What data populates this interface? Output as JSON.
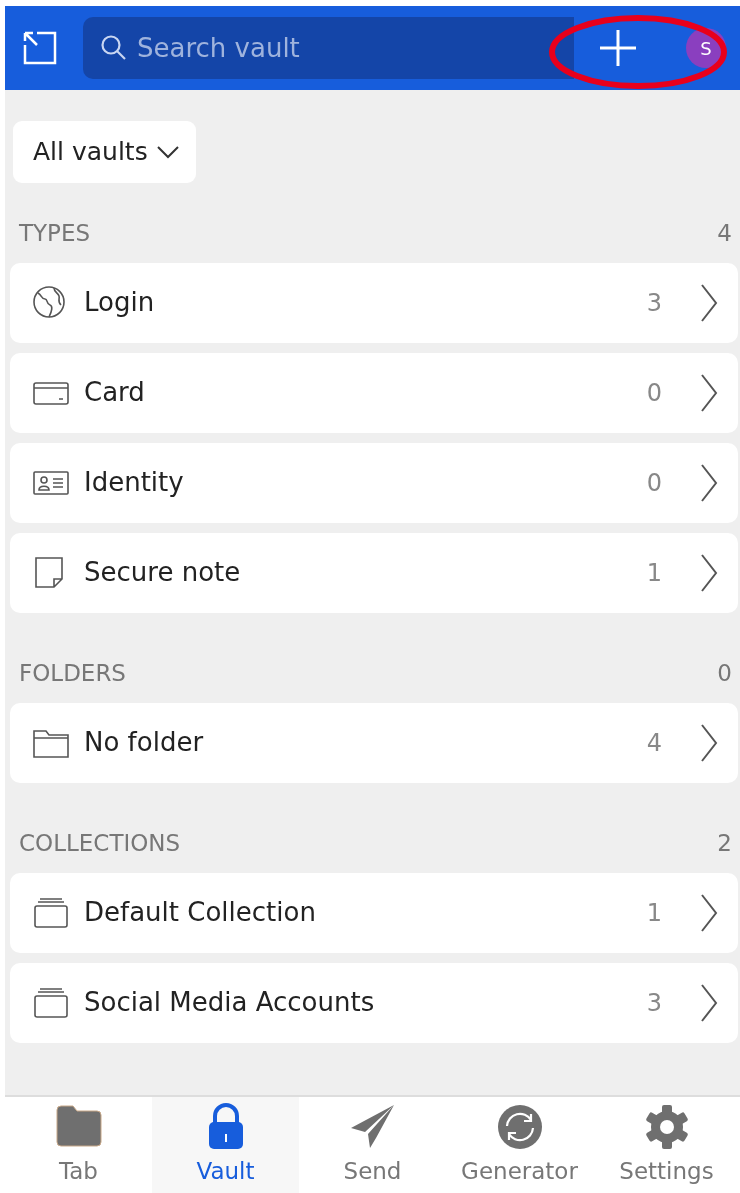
{
  "header": {
    "search": {
      "placeholder": "Search vault"
    },
    "avatar": "S",
    "add_button_circled": true
  },
  "vault_filter": "All vaults",
  "sections": [
    {
      "title": "TYPES",
      "count": "4",
      "items": [
        {
          "kind": "login",
          "label": "Login",
          "count": "3"
        },
        {
          "kind": "card",
          "label": "Card",
          "count": "0"
        },
        {
          "kind": "identity",
          "label": "Identity",
          "count": "0"
        },
        {
          "kind": "note",
          "label": "Secure note",
          "count": "1"
        }
      ]
    },
    {
      "title": "FOLDERS",
      "count": "0",
      "items": [
        {
          "kind": "folder",
          "label": "No folder",
          "count": "4"
        }
      ]
    },
    {
      "title": "COLLECTIONS",
      "count": "2",
      "items": [
        {
          "kind": "collection",
          "label": "Default Collection",
          "count": "1"
        },
        {
          "kind": "collection",
          "label": "Social Media Accounts",
          "count": "3"
        }
      ]
    }
  ],
  "tabs": [
    {
      "kind": "tab",
      "label": "Tab",
      "selected": false
    },
    {
      "kind": "vault",
      "label": "Vault",
      "selected": true
    },
    {
      "kind": "send",
      "label": "Send",
      "selected": false
    },
    {
      "kind": "generator",
      "label": "Generator",
      "selected": false
    },
    {
      "kind": "settings",
      "label": "Settings",
      "selected": false
    }
  ]
}
